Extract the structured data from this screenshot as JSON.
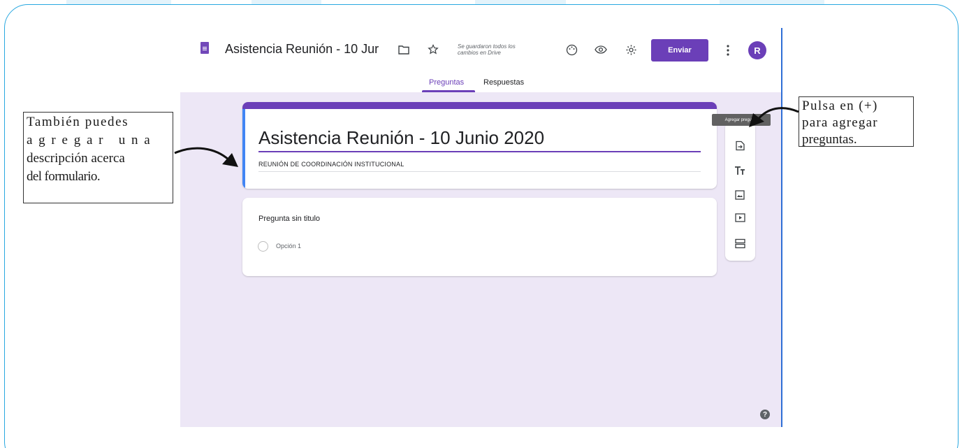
{
  "app": {
    "doc_title": "Asistencia Reunión - 10 Jur",
    "saved_status": "Se guardaron todos los cambios en Drive",
    "send_label": "Enviar",
    "avatar_initial": "R",
    "tabs": [
      {
        "label": "Preguntas",
        "active": true
      },
      {
        "label": "Respuestas",
        "active": false
      }
    ]
  },
  "form": {
    "title": "Asistencia Reunión - 10 Junio 2020",
    "description": "REUNIÓN DE COORDINACIÓN INSTITUCIONAL",
    "question": {
      "title": "Pregunta sin titulo",
      "options": [
        "Opción 1"
      ]
    }
  },
  "toolbar": {
    "tooltip": "Agregar pregunta",
    "items": [
      "add-question-icon",
      "import-questions-icon",
      "title-text-icon",
      "image-icon",
      "video-icon",
      "section-icon"
    ]
  },
  "callouts": {
    "left": {
      "lines": [
        "También puedes",
        "a g r e g a r   u n a",
        "descripción acerca",
        "del formulario."
      ]
    },
    "right": {
      "lines": [
        "Pulsa en (+)",
        "para agregar",
        "preguntas."
      ]
    }
  },
  "colors": {
    "accent": "#6b3fb8",
    "canvas": "#ede7f6",
    "frame_border": "#29a8e0",
    "description_bar": "#4285f4"
  }
}
